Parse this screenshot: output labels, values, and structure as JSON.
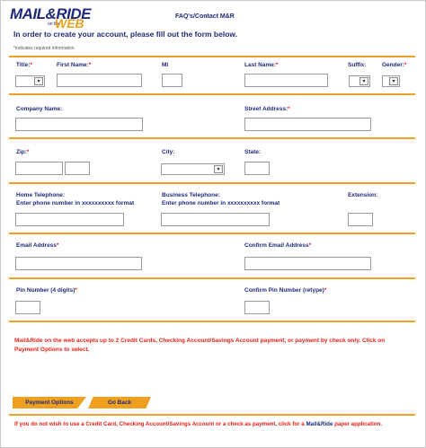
{
  "logo": {
    "main": "MAIL&RIDE",
    "on_the": "on the",
    "web": "WEB"
  },
  "header": {
    "faq_link": "FAQ's/Contact M&R"
  },
  "intro": "In order to create your account, please fill out the form below.",
  "required_note": "*indicates required information.",
  "row1": {
    "title": "Title:",
    "first_name": "First Name:",
    "mi": "MI",
    "last_name": "Last Name:",
    "suffix": "Suffix:",
    "gender": "Gender:"
  },
  "row2": {
    "company_name": "Company Name:",
    "street_address": "Street Address:"
  },
  "row3": {
    "zip": "Zip:",
    "city": "City:",
    "state": "State:"
  },
  "row4": {
    "home_telephone": "Home Telephone:",
    "home_format": "Enter phone number in xxxxxxxxxx format",
    "business_telephone": "Business Telephone:",
    "business_format": "Enter phone number in xxxxxxxxxx format",
    "extension": "Extension:"
  },
  "row5": {
    "email": "Email Address",
    "confirm_email": "Confirm Email Address"
  },
  "row6": {
    "pin": "Pin Number (4 digits)",
    "confirm_pin": "Confirm Pin Number (retype)"
  },
  "required_mark": "*",
  "payment_note": "Mail&Ride on the web accepts up to 2 Credit Cards, Checking Account/Savings Account payment, or payment by check only. Click on Payment Options to select.",
  "buttons": {
    "payment_options": "Payment Options",
    "go_back": "Go Back"
  },
  "footnote": {
    "text": "If you do not wish to use a Credit Card, Checking Account/Savings Account or a check as payment, click for a ",
    "link": "Mail&Ride",
    "suffix": " paper application."
  },
  "colors": {
    "accent": "#f0a020",
    "navy": "#1f2a7a",
    "red": "#e8201a"
  }
}
